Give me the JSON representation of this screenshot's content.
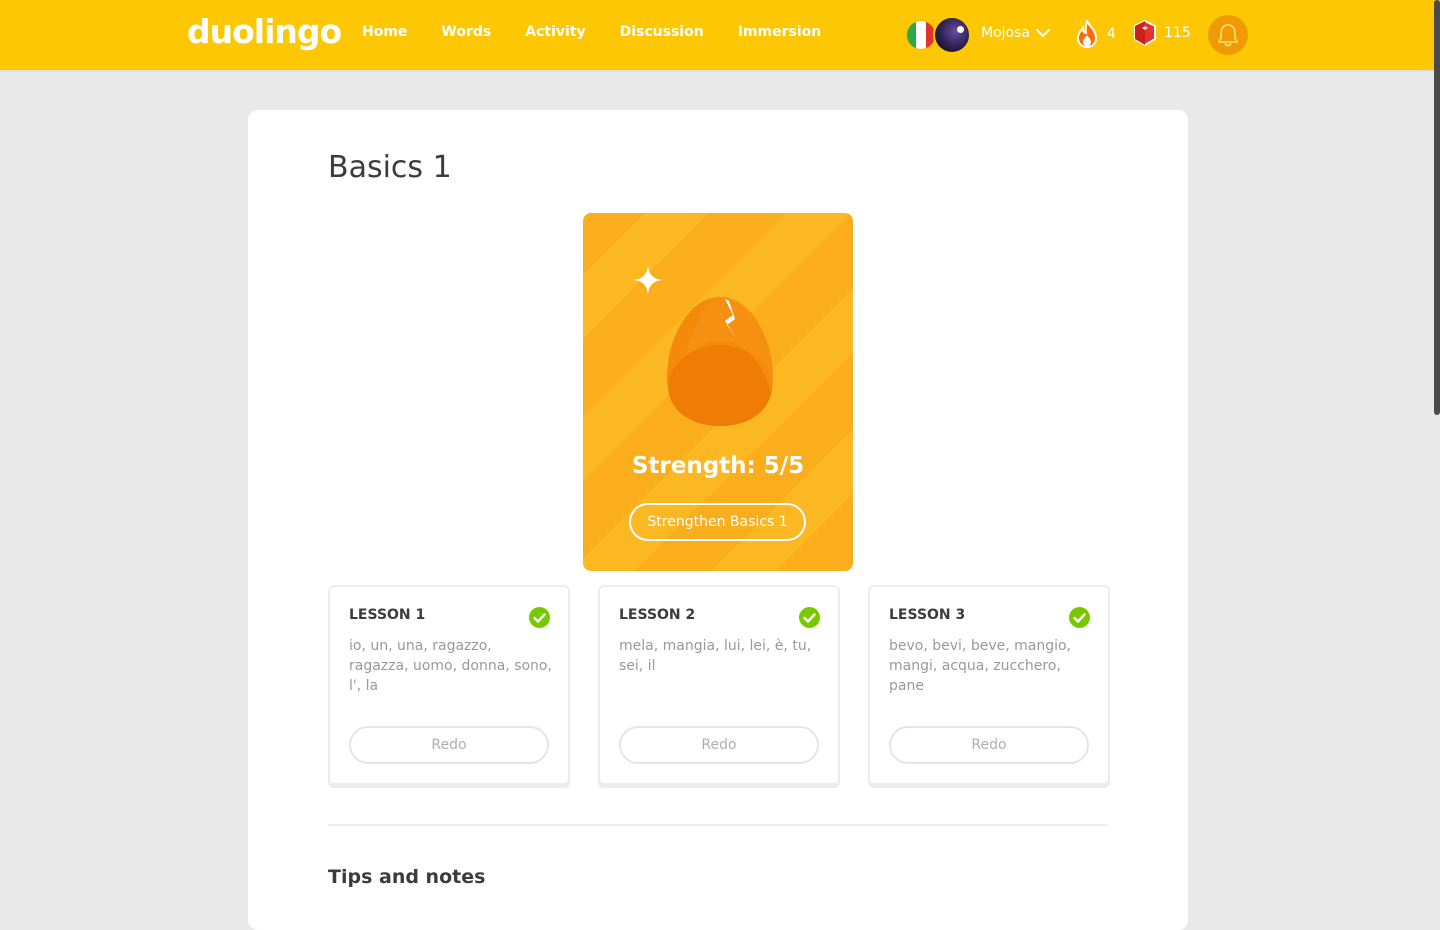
{
  "header": {
    "logo": "duolingo",
    "nav": [
      "Home",
      "Words",
      "Activity",
      "Discussion",
      "Immersion"
    ],
    "username": "Mojosa",
    "streak": "4",
    "gems": "115",
    "colors": {
      "bar": "#fec703",
      "bell": "#f29a05"
    }
  },
  "skill": {
    "title": "Basics 1",
    "strength_text": "Strength: 5/5",
    "strength_value": 1.0,
    "button": "Strengthen Basics 1"
  },
  "lessons": [
    {
      "label": "LESSON 1",
      "words": "io, un, una, ragazzo, ragazza, uomo, donna, sono, l', la",
      "button": "Redo",
      "completed": true
    },
    {
      "label": "LESSON 2",
      "words": "mela, mangia, lui, lei, è, tu, sei, il",
      "button": "Redo",
      "completed": true
    },
    {
      "label": "LESSON 3",
      "words": "bevo, bevi, beve, mangio, mangi, acqua, zucchero, pane",
      "button": "Redo",
      "completed": true
    }
  ],
  "tips": {
    "heading": "Tips and notes"
  }
}
